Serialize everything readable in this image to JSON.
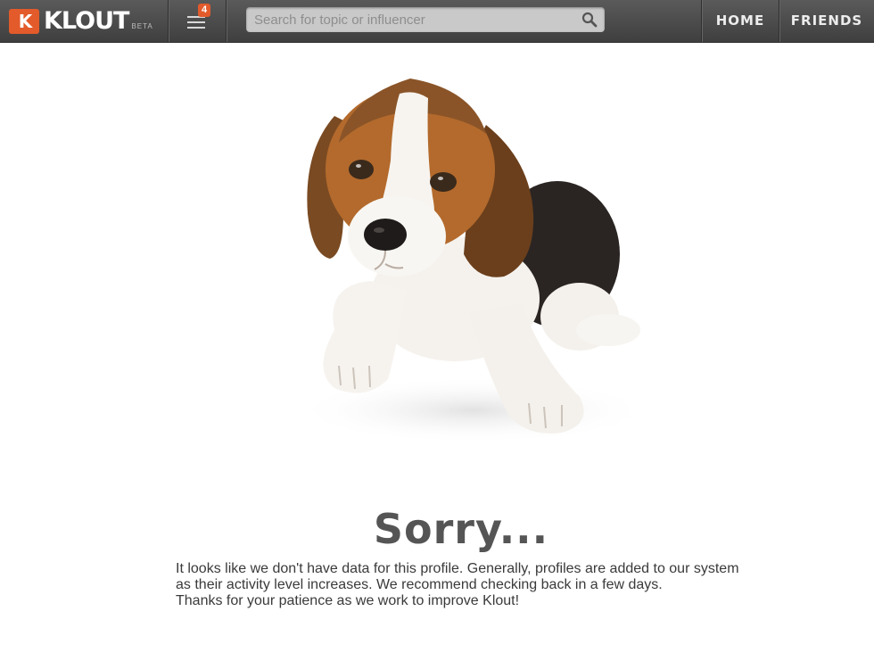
{
  "header": {
    "logo_mark": "K",
    "logo_text": "KLOUT",
    "logo_badge": "BETA",
    "notification_count": "4",
    "search": {
      "placeholder": "Search for topic or influencer",
      "value": ""
    },
    "nav": [
      {
        "label": "HOME"
      },
      {
        "label": "FRIENDS"
      }
    ]
  },
  "content": {
    "title": "Sorry...",
    "message": "It looks like we don't have data for this profile. Generally, profiles are added to our system as their activity level increases. We recommend checking back in a few days.",
    "thanks": "Thanks for your patience as we work to improve Klout!"
  },
  "colors": {
    "accent": "#e35a2b",
    "topbar": "#4a4a4a",
    "title": "#555555"
  },
  "icons": [
    "notifications-menu-icon",
    "search-icon",
    "sad-puppy-illustration"
  ]
}
